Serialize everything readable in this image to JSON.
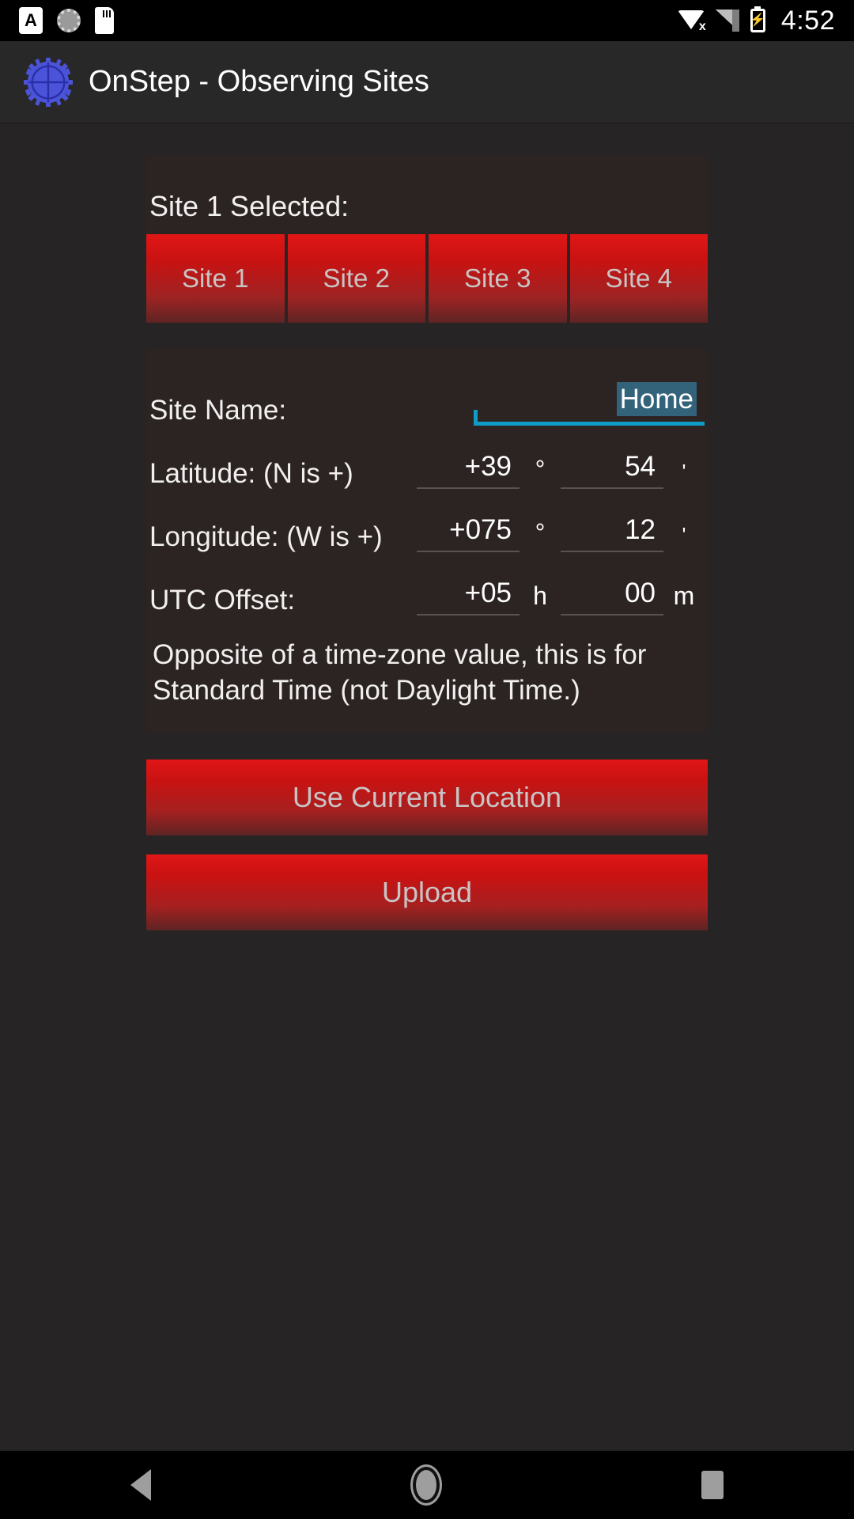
{
  "status_bar": {
    "icons": [
      "font-size-a-icon",
      "sync-icon",
      "sd-card-icon"
    ],
    "wifi_icon": "wifi-off-icon",
    "signal_icon": "cell-signal-icon",
    "battery_icon": "battery-charging-icon",
    "battery_glyph": "⚡",
    "a_glyph": "A",
    "clock": "4:52"
  },
  "app_bar": {
    "logo": "onstep-gear-crosshair-logo",
    "title": "OnStep - Observing Sites"
  },
  "sites_panel": {
    "selected_label": "Site 1 Selected:",
    "buttons": [
      {
        "label": "Site 1"
      },
      {
        "label": "Site 2"
      },
      {
        "label": "Site 3"
      },
      {
        "label": "Site 4"
      }
    ]
  },
  "form": {
    "site_name": {
      "label": "Site Name:",
      "value": "Home",
      "selected": true
    },
    "latitude": {
      "label": "Latitude: (N is +)",
      "degrees": "+39",
      "degrees_unit": "°",
      "minutes": "54",
      "minutes_unit": "'"
    },
    "longitude": {
      "label": "Longitude: (W is +)",
      "degrees": "+075",
      "degrees_unit": "°",
      "minutes": "12",
      "minutes_unit": "'"
    },
    "utc_offset": {
      "label": "UTC Offset:",
      "hours": "+05",
      "hours_unit": "h",
      "minutes": "00",
      "minutes_unit": "m"
    },
    "help_text": "Opposite of a time-zone value, this is for Standard Time (not Daylight Time.)"
  },
  "actions": {
    "use_current_location": "Use Current Location",
    "upload": "Upload"
  },
  "nav_bar": {
    "back": "back-icon",
    "home": "home-icon",
    "recent": "recent-apps-icon"
  },
  "colors": {
    "accent_red": "#c91212",
    "selection_teal": "#33637a",
    "underline_cyan": "#0f9cc6",
    "logo_blue": "#4b53d8",
    "panel_bg": "#2c2423",
    "page_bg": "#262424"
  }
}
